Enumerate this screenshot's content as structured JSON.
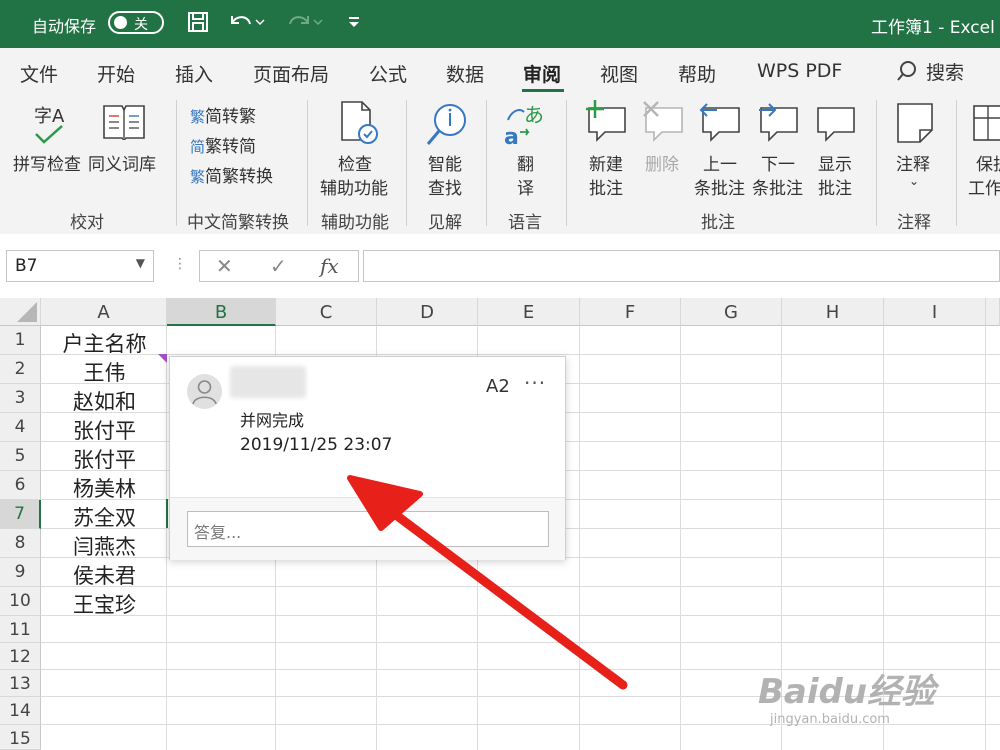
{
  "titlebar": {
    "autosave_label": "自动保存",
    "autosave_state": "关",
    "doc_title": "工作簿1 - Excel"
  },
  "tabs": [
    "文件",
    "开始",
    "插入",
    "页面布局",
    "公式",
    "数据",
    "审阅",
    "视图",
    "帮助",
    "WPS PDF"
  ],
  "active_tab": "审阅",
  "search_label": "搜索",
  "ribbon": {
    "spellcheck": "拼写检查",
    "thesaurus": "同义词库",
    "proofing_group": "校对",
    "to_traditional": "简转繁",
    "to_simplified": "繁转简",
    "convert": "简繁转换",
    "chinese_group": "中文简繁转换",
    "accessibility_1": "检查",
    "accessibility_2": "辅助功能",
    "accessibility_group": "辅助功能",
    "smart_lookup_1": "智能",
    "smart_lookup_2": "查找",
    "insights_group": "见解",
    "translate_1": "翻",
    "translate_2": "译",
    "language_group": "语言",
    "new_comment_1": "新建",
    "new_comment_2": "批注",
    "delete": "删除",
    "prev_1": "上一",
    "prev_2": "条批注",
    "next_1": "下一",
    "next_2": "条批注",
    "show_1": "显示",
    "show_2": "批注",
    "comments_group": "批注",
    "notes_label": "注释",
    "notes_group": "注释",
    "protect_1": "保护",
    "protect_2": "工作"
  },
  "formula_bar": {
    "name_box": "B7",
    "fx": "fx",
    "formula": ""
  },
  "columns": [
    "A",
    "B",
    "C",
    "D",
    "E",
    "F",
    "G",
    "H",
    "I"
  ],
  "rows": [
    "1",
    "2",
    "3",
    "4",
    "5",
    "6",
    "7",
    "8",
    "9",
    "10",
    "11",
    "12",
    "13",
    "14",
    "15"
  ],
  "cells_A": [
    "户主名称",
    "王伟",
    "赵如和",
    "张付平",
    "张付平",
    "杨美林",
    "苏全双",
    "闫燕杰",
    "侯未君",
    "王宝珍"
  ],
  "comment": {
    "cell_ref": "A2",
    "more": "···",
    "text": "并网完成",
    "timestamp": "2019/11/25 23:07",
    "reply_placeholder": "答复..."
  },
  "watermark": {
    "logo": "Baidu经验",
    "url": "jingyan.baidu.com"
  },
  "colors": {
    "brand_green": "#217346",
    "arrow_red": "#e8201a",
    "comment_marker": "#a54ec8"
  }
}
